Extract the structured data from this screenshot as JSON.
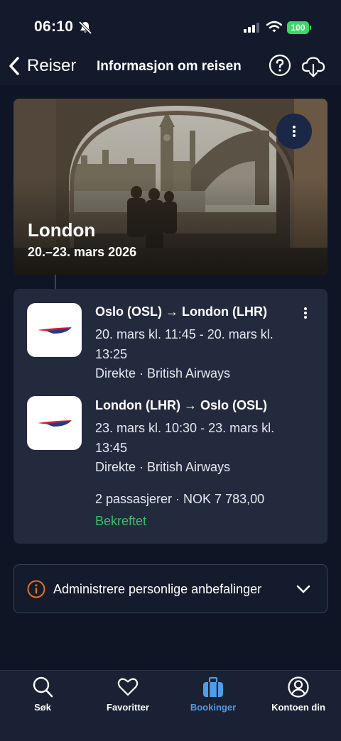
{
  "status_bar": {
    "time": "06:10",
    "battery": "100"
  },
  "nav": {
    "back_label": "Reiser",
    "title": "Informasjon om reisen"
  },
  "trip": {
    "destination": "London",
    "dates": "20.–23. mars 2026"
  },
  "flights": [
    {
      "route": "Oslo (OSL) → London (LHR)",
      "times": "20. mars kl. 11:45 - 20. mars kl. 13:25",
      "info": "Direkte · British Airways"
    },
    {
      "route": "London (LHR) → Oslo (OSL)",
      "times": "23. mars kl. 10:30 - 23. mars kl. 13:45",
      "info": "Direkte · British Airways"
    }
  ],
  "booking": {
    "summary": "2 passasjerer · NOK 7 783,00",
    "status": "Bekreftet"
  },
  "accordion": {
    "label": "Administrere personlige anbefalinger"
  },
  "tabs": [
    {
      "label": "Søk",
      "icon": "search-icon"
    },
    {
      "label": "Favoritter",
      "icon": "heart-icon"
    },
    {
      "label": "Bookinger",
      "icon": "suitcase-icon",
      "active": true
    },
    {
      "label": "Kontoen din",
      "icon": "user-icon"
    }
  ],
  "colors": {
    "accent": "#4e9de8",
    "confirmed": "#3dbb6b",
    "card": "#232a3e",
    "background": "#0f1524"
  }
}
